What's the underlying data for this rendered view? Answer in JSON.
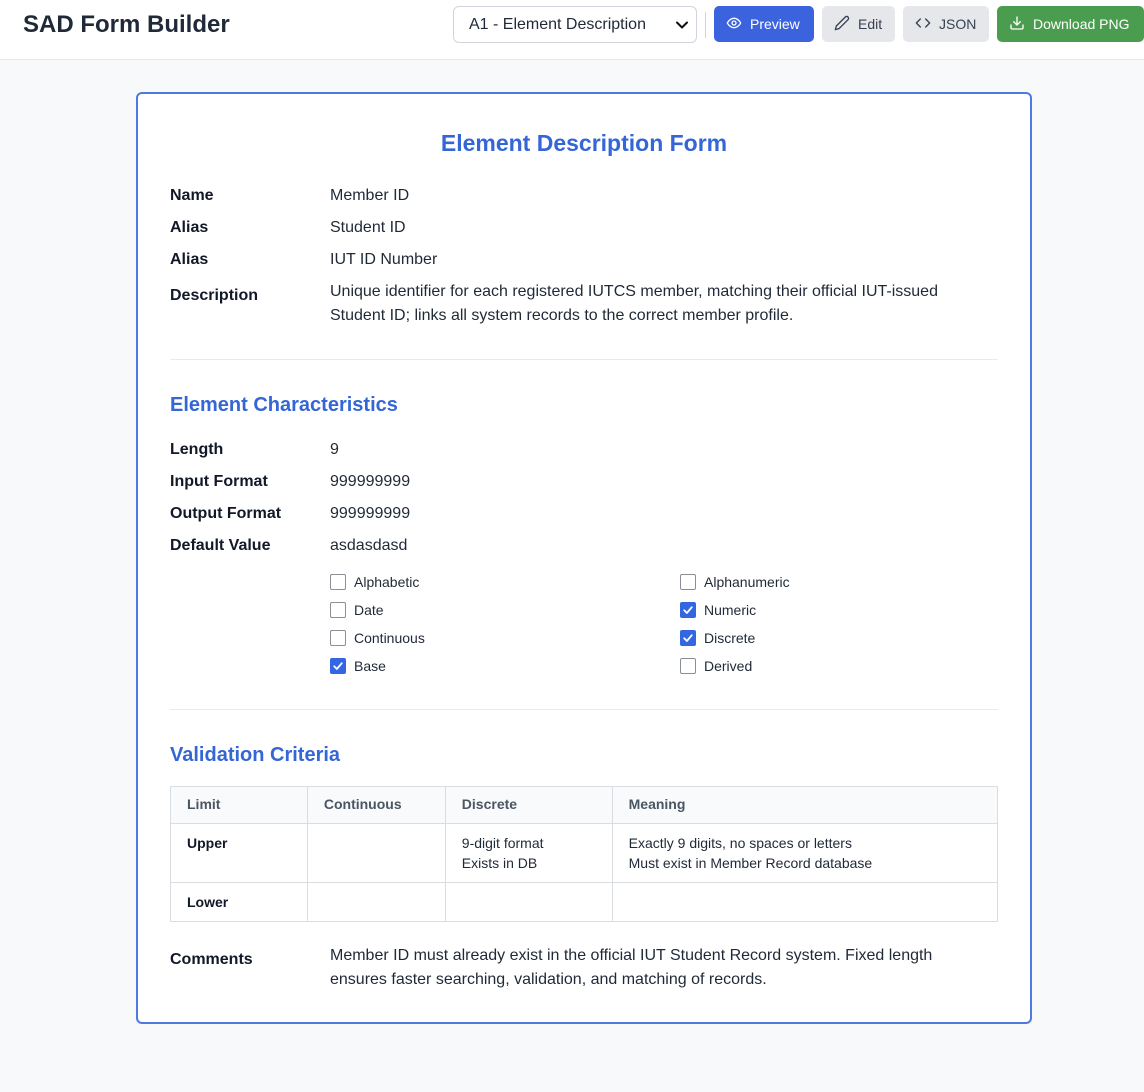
{
  "header": {
    "app_title": "SAD Form Builder",
    "template_select": {
      "selected": "A1 - Element Description",
      "options": [
        "A1 - Element Description"
      ]
    },
    "buttons": {
      "preview": "Preview",
      "edit": "Edit",
      "json": "JSON",
      "download": "Download PNG"
    },
    "icons": {
      "preview": "eye-icon",
      "edit": "pencil-icon",
      "json": "code-icon",
      "download": "download-icon",
      "select": "chevron-down-icon"
    },
    "colors": {
      "primary": "#3b63de",
      "download": "#4a9d4f",
      "secondary": "#e5e7eb"
    }
  },
  "form": {
    "title": "Element Description Form",
    "fields": [
      {
        "label": "Name",
        "value": "Member ID"
      },
      {
        "label": "Alias",
        "value": "Student ID"
      },
      {
        "label": "Alias",
        "value": "IUT ID Number"
      },
      {
        "label": "Description",
        "value": "Unique identifier for each registered IUTCS member, matching their official IUT-issued Student ID; links all system records to the correct member profile."
      }
    ],
    "characteristics": {
      "title": "Element Characteristics",
      "fields": [
        {
          "label": "Length",
          "value": "9"
        },
        {
          "label": "Input Format",
          "value": "999999999"
        },
        {
          "label": "Output Format",
          "value": "999999999"
        },
        {
          "label": "Default Value",
          "value": "asdasdasd"
        }
      ],
      "checkboxes": [
        {
          "label": "Alphabetic",
          "checked": false
        },
        {
          "label": "Alphanumeric",
          "checked": false
        },
        {
          "label": "Date",
          "checked": false
        },
        {
          "label": "Numeric",
          "checked": true
        },
        {
          "label": "Continuous",
          "checked": false
        },
        {
          "label": "Discrete",
          "checked": true
        },
        {
          "label": "Base",
          "checked": true
        },
        {
          "label": "Derived",
          "checked": false
        }
      ]
    },
    "validation": {
      "title": "Validation Criteria",
      "columns": [
        "Limit",
        "Continuous",
        "Discrete",
        "Meaning"
      ],
      "rows": [
        {
          "limit": "Upper",
          "continuous": "",
          "discrete": "9-digit format\nExists in DB",
          "meaning": "Exactly 9 digits, no spaces or letters\nMust exist in Member Record database"
        },
        {
          "limit": "Lower",
          "continuous": "",
          "discrete": "",
          "meaning": ""
        }
      ]
    },
    "comments": {
      "label": "Comments",
      "value": "Member ID must already exist in the official IUT Student Record system. Fixed length ensures faster searching, validation, and matching of records."
    },
    "colors": {
      "accent": "#3566d6",
      "card_border": "#4f79e0",
      "checkbox_checked": "#3366e0"
    }
  }
}
